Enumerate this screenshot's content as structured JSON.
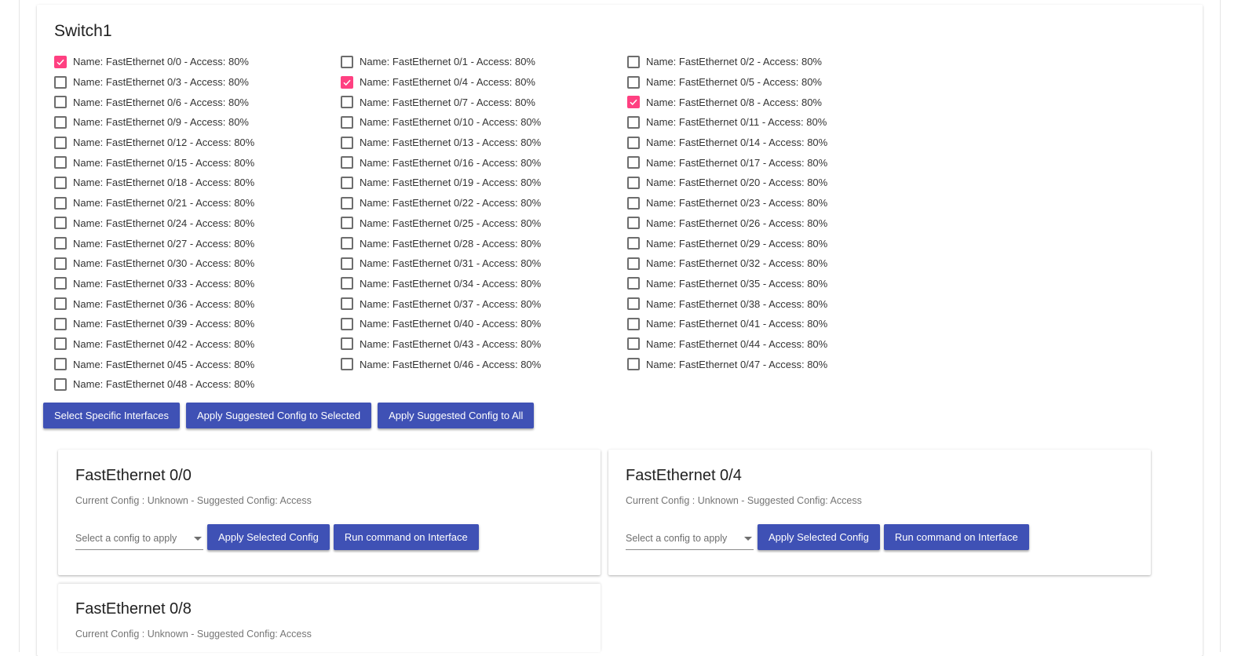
{
  "switch": {
    "title": "Switch1",
    "interfaces": [
      {
        "label": "Name: FastEthernet 0/0 - Access: 80%",
        "checked": true
      },
      {
        "label": "Name: FastEthernet 0/1 - Access: 80%",
        "checked": false
      },
      {
        "label": "Name: FastEthernet 0/2 - Access: 80%",
        "checked": false
      },
      {
        "label": "Name: FastEthernet 0/3 - Access: 80%",
        "checked": false
      },
      {
        "label": "Name: FastEthernet 0/4 - Access: 80%",
        "checked": true
      },
      {
        "label": "Name: FastEthernet 0/5 - Access: 80%",
        "checked": false
      },
      {
        "label": "Name: FastEthernet 0/6 - Access: 80%",
        "checked": false
      },
      {
        "label": "Name: FastEthernet 0/7 - Access: 80%",
        "checked": false
      },
      {
        "label": "Name: FastEthernet 0/8 - Access: 80%",
        "checked": true
      },
      {
        "label": "Name: FastEthernet 0/9 - Access: 80%",
        "checked": false
      },
      {
        "label": "Name: FastEthernet 0/10 - Access: 80%",
        "checked": false
      },
      {
        "label": "Name: FastEthernet 0/11 - Access: 80%",
        "checked": false
      },
      {
        "label": "Name: FastEthernet 0/12 - Access: 80%",
        "checked": false
      },
      {
        "label": "Name: FastEthernet 0/13 - Access: 80%",
        "checked": false
      },
      {
        "label": "Name: FastEthernet 0/14 - Access: 80%",
        "checked": false
      },
      {
        "label": "Name: FastEthernet 0/15 - Access: 80%",
        "checked": false
      },
      {
        "label": "Name: FastEthernet 0/16 - Access: 80%",
        "checked": false
      },
      {
        "label": "Name: FastEthernet 0/17 - Access: 80%",
        "checked": false
      },
      {
        "label": "Name: FastEthernet 0/18 - Access: 80%",
        "checked": false
      },
      {
        "label": "Name: FastEthernet 0/19 - Access: 80%",
        "checked": false
      },
      {
        "label": "Name: FastEthernet 0/20 - Access: 80%",
        "checked": false
      },
      {
        "label": "Name: FastEthernet 0/21 - Access: 80%",
        "checked": false
      },
      {
        "label": "Name: FastEthernet 0/22 - Access: 80%",
        "checked": false
      },
      {
        "label": "Name: FastEthernet 0/23 - Access: 80%",
        "checked": false
      },
      {
        "label": "Name: FastEthernet 0/24 - Access: 80%",
        "checked": false
      },
      {
        "label": "Name: FastEthernet 0/25 - Access: 80%",
        "checked": false
      },
      {
        "label": "Name: FastEthernet 0/26 - Access: 80%",
        "checked": false
      },
      {
        "label": "Name: FastEthernet 0/27 - Access: 80%",
        "checked": false
      },
      {
        "label": "Name: FastEthernet 0/28 - Access: 80%",
        "checked": false
      },
      {
        "label": "Name: FastEthernet 0/29 - Access: 80%",
        "checked": false
      },
      {
        "label": "Name: FastEthernet 0/30 - Access: 80%",
        "checked": false
      },
      {
        "label": "Name: FastEthernet 0/31 - Access: 80%",
        "checked": false
      },
      {
        "label": "Name: FastEthernet 0/32 - Access: 80%",
        "checked": false
      },
      {
        "label": "Name: FastEthernet 0/33 - Access: 80%",
        "checked": false
      },
      {
        "label": "Name: FastEthernet 0/34 - Access: 80%",
        "checked": false
      },
      {
        "label": "Name: FastEthernet 0/35 - Access: 80%",
        "checked": false
      },
      {
        "label": "Name: FastEthernet 0/36 - Access: 80%",
        "checked": false
      },
      {
        "label": "Name: FastEthernet 0/37 - Access: 80%",
        "checked": false
      },
      {
        "label": "Name: FastEthernet 0/38 - Access: 80%",
        "checked": false
      },
      {
        "label": "Name: FastEthernet 0/39 - Access: 80%",
        "checked": false
      },
      {
        "label": "Name: FastEthernet 0/40 - Access: 80%",
        "checked": false
      },
      {
        "label": "Name: FastEthernet 0/41 - Access: 80%",
        "checked": false
      },
      {
        "label": "Name: FastEthernet 0/42 - Access: 80%",
        "checked": false
      },
      {
        "label": "Name: FastEthernet 0/43 - Access: 80%",
        "checked": false
      },
      {
        "label": "Name: FastEthernet 0/44 - Access: 80%",
        "checked": false
      },
      {
        "label": "Name: FastEthernet 0/45 - Access: 80%",
        "checked": false
      },
      {
        "label": "Name: FastEthernet 0/46 - Access: 80%",
        "checked": false
      },
      {
        "label": "Name: FastEthernet 0/47 - Access: 80%",
        "checked": false
      },
      {
        "label": "Name: FastEthernet 0/48 - Access: 80%",
        "checked": false
      }
    ]
  },
  "actions": {
    "select_specific": "Select Specific Interfaces",
    "apply_selected": "Apply Suggested Config to Selected",
    "apply_all": "Apply Suggested Config to All"
  },
  "cards": [
    {
      "title": "FastEthernet 0/0",
      "subtitle": "Current Config : Unknown - Suggested Config: Access",
      "select_placeholder": "Select a config to apply",
      "apply_label": "Apply Selected Config",
      "run_label": "Run command on Interface"
    },
    {
      "title": "FastEthernet 0/4",
      "subtitle": "Current Config : Unknown - Suggested Config: Access",
      "select_placeholder": "Select a config to apply",
      "apply_label": "Apply Selected Config",
      "run_label": "Run command on Interface"
    },
    {
      "title": "FastEthernet 0/8",
      "subtitle": "Current Config : Unknown - Suggested Config: Access"
    }
  ],
  "colors": {
    "primary": "#3f51b5",
    "accent": "#ff4081",
    "checkbox_border": "#6d6d6d"
  },
  "icons": {
    "checkmark": "check-icon",
    "dropdown": "dropdown-arrow-icon"
  }
}
